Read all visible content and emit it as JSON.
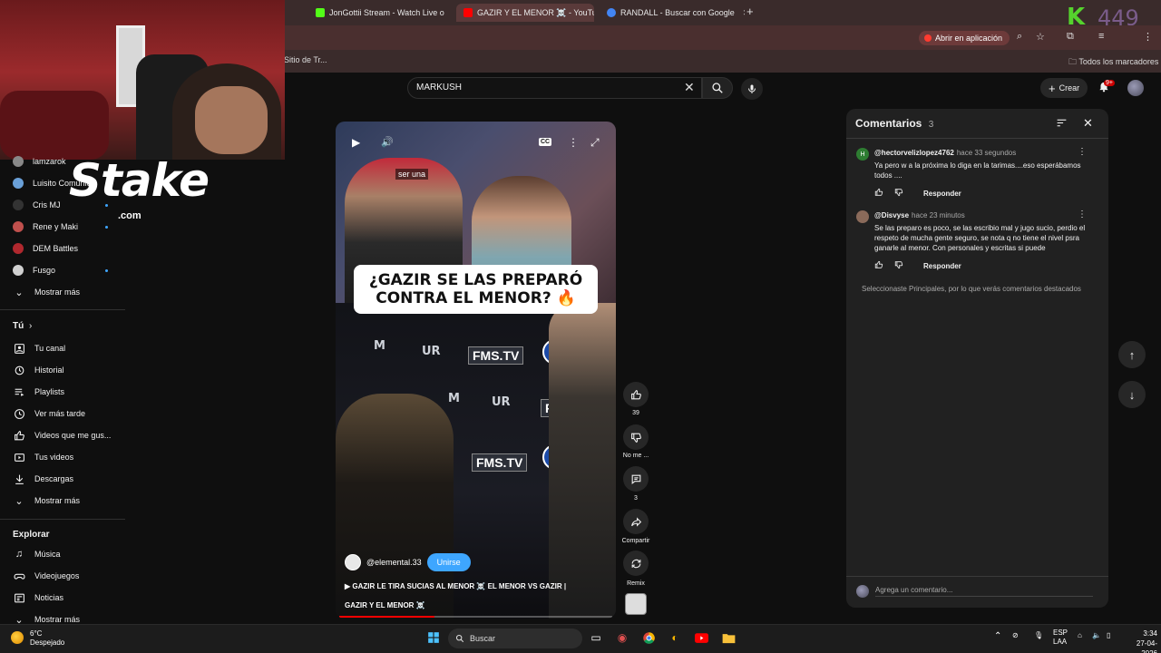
{
  "browser": {
    "tabs": [
      {
        "label": "JonGottii Stream - Watch Live o",
        "color": "#53fc18"
      },
      {
        "label": "GAZIR Y EL MENOR ☠️ - YouTu",
        "color": "#ff0000"
      },
      {
        "label": "RANDALL - Buscar con Google",
        "color": "#4285f4"
      }
    ],
    "open_app_label": "Abrir en aplicación",
    "bookmark_left": "Sitio de Tr...",
    "bookmark_right": "Todos los marcadores",
    "kick_letter": "K",
    "kick_count": "449"
  },
  "youtube": {
    "search_value": "MARKUSH",
    "create_label": "Crear",
    "notification_badge": "9+"
  },
  "sidebar": {
    "channels": [
      {
        "label": "lamzarok",
        "color": "#888888",
        "live": false
      },
      {
        "label": "Luisito Comunica",
        "color": "#6aa0d8",
        "live": true
      },
      {
        "label": "Cris MJ",
        "color": "#333333",
        "live": true
      },
      {
        "label": "Rene y Maki",
        "color": "#c0504d",
        "live": true
      },
      {
        "label": "DEM Battles",
        "color": "#b0282e",
        "live": false
      },
      {
        "label": "Fusgo",
        "color": "#d0d0d0",
        "live": true
      }
    ],
    "show_more_1": "Mostrar más",
    "you_header": "Tú",
    "you_items": [
      {
        "label": "Tu canal",
        "icon": "user-icon"
      },
      {
        "label": "Historial",
        "icon": "history-icon"
      },
      {
        "label": "Playlists",
        "icon": "playlist-icon"
      },
      {
        "label": "Ver más tarde",
        "icon": "clock-icon"
      },
      {
        "label": "Videos que me gus...",
        "icon": "thumbs-up-icon"
      },
      {
        "label": "Tus videos",
        "icon": "video-icon"
      },
      {
        "label": "Descargas",
        "icon": "download-icon"
      }
    ],
    "show_more_2": "Mostrar más",
    "explore_header": "Explorar",
    "explore_items": [
      {
        "label": "Música",
        "icon": "music-icon"
      },
      {
        "label": "Videojuegos",
        "icon": "gamepad-icon"
      },
      {
        "label": "Noticias",
        "icon": "news-icon"
      }
    ],
    "show_more_3": "Mostrar más",
    "sponsor_logo": "Stake",
    "sponsor_suffix": ".com"
  },
  "short": {
    "subtitle": "ser una",
    "caption": "¿GAZIR SE LAS PREPARÓ CONTRA EL MENOR? 🔥",
    "wall_brand": "FMS.TV",
    "channel": "@elemental.33",
    "join_label": "Unirse",
    "title_line_1": "▶ GAZIR LE TIRA SUCIAS AL MENOR ☠️ EL MENOR VS GAZIR |",
    "title_line_2": "GAZIR Y EL MENOR ☠️",
    "progress": 0.35,
    "like_count": "39",
    "dislike_label": "No me ...",
    "comment_count": "3",
    "share_label": "Compartir",
    "remix_label": "Remix"
  },
  "comments": {
    "title": "Comentarios",
    "count": "3",
    "items": [
      {
        "avatar_letter": "H",
        "avatar_color": "#2e7d32",
        "user": "@hectorvelizlopez4762",
        "time": "hace 33 segundos",
        "text": "Ya pero w a la próxima lo diga en la tarimas....eso esperábamos todos ....",
        "reply": "Responder"
      },
      {
        "avatar_letter": "",
        "avatar_color": "#8a6a5a",
        "user": "@Disvyse",
        "time": "hace 23 minutos",
        "text": "Se las preparo es poco, se las escribio mal y jugo sucio, perdio el respeto de mucha gente seguro, se nota q no tiene el nivel psra ganarle al menor. Con personales y escritas si puede",
        "reply": "Responder"
      }
    ],
    "note": "Seleccionaste Principales, por lo que verás comentarios destacados",
    "add_placeholder": "Agrega un comentario..."
  },
  "taskbar": {
    "temp": "6°C",
    "weather": "Despejado",
    "search_label": "Buscar",
    "lang_1": "ESP",
    "lang_2": "LAA",
    "time": "3:34",
    "date": "27-04-2026"
  }
}
